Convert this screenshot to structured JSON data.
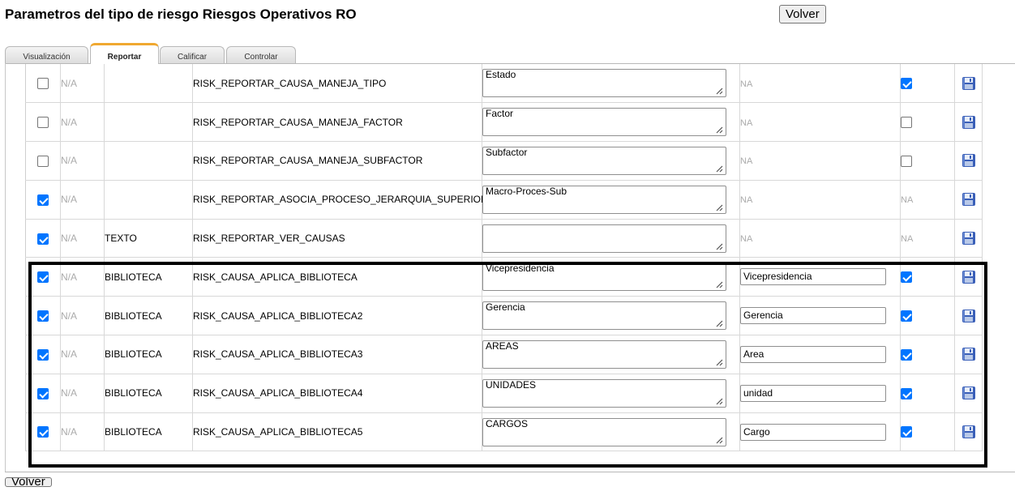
{
  "page": {
    "title": "Parametros del tipo de riesgo Riesgos Operativos RO",
    "volver_label": "Volver",
    "volver_bottom_label": "Volver"
  },
  "tabs": [
    {
      "label": "Visualización",
      "active": false
    },
    {
      "label": "Reportar",
      "active": true
    },
    {
      "label": "Calificar",
      "active": false
    },
    {
      "label": "Controlar",
      "active": false
    }
  ],
  "colors": {
    "active_tab_accent": "#f0a830",
    "checkbox_checked": "#0075ff",
    "highlight_border": "#000000",
    "save_icon_blue": "#3a5fb8"
  },
  "rows": [
    {
      "enabled": false,
      "na": "N/A",
      "type": "",
      "key": "RISK_REPORTAR_CAUSA_MANEJA_TIPO",
      "text": "Estado",
      "value_na": "NA",
      "value": null,
      "flag": "checked",
      "icon": "save-icon"
    },
    {
      "enabled": false,
      "na": "N/A",
      "type": "",
      "key": "RISK_REPORTAR_CAUSA_MANEJA_FACTOR",
      "text": "Factor",
      "value_na": "NA",
      "value": null,
      "flag": "unchecked",
      "icon": "save-icon"
    },
    {
      "enabled": false,
      "na": "N/A",
      "type": "",
      "key": "RISK_REPORTAR_CAUSA_MANEJA_SUBFACTOR",
      "text": "Subfactor",
      "value_na": "NA",
      "value": null,
      "flag": "unchecked",
      "icon": "save-icon"
    },
    {
      "enabled": true,
      "na": "N/A",
      "type": "",
      "key": "RISK_REPORTAR_ASOCIA_PROCESO_JERARQUIA_SUPERIOR",
      "text": "Macro-Proces-Sub",
      "value_na": "NA",
      "value": null,
      "flag": "NA",
      "icon": "save-icon"
    },
    {
      "enabled": true,
      "na": "N/A",
      "type": "TEXTO",
      "key": "RISK_REPORTAR_VER_CAUSAS",
      "text": "",
      "value_na": "NA",
      "value": null,
      "flag": "NA",
      "icon": "save-icon"
    },
    {
      "enabled": true,
      "na": "N/A",
      "type": "BIBLIOTECA",
      "key": "RISK_CAUSA_APLICA_BIBLIOTECA",
      "text": "Vicepresidencia",
      "value_na": null,
      "value": "Vicepresidencia",
      "flag": "checked",
      "icon": "save-icon"
    },
    {
      "enabled": true,
      "na": "N/A",
      "type": "BIBLIOTECA",
      "key": "RISK_CAUSA_APLICA_BIBLIOTECA2",
      "text": "Gerencia",
      "value_na": null,
      "value": "Gerencia",
      "flag": "checked",
      "icon": "save-icon"
    },
    {
      "enabled": true,
      "na": "N/A",
      "type": "BIBLIOTECA",
      "key": "RISK_CAUSA_APLICA_BIBLIOTECA3",
      "text": "AREAS",
      "value_na": null,
      "value": "Area",
      "flag": "checked",
      "icon": "save-icon"
    },
    {
      "enabled": true,
      "na": "N/A",
      "type": "BIBLIOTECA",
      "key": "RISK_CAUSA_APLICA_BIBLIOTECA4",
      "text": "UNIDADES",
      "value_na": null,
      "value": "unidad",
      "flag": "checked",
      "icon": "save-icon"
    },
    {
      "enabled": true,
      "na": "N/A",
      "type": "BIBLIOTECA",
      "key": "RISK_CAUSA_APLICA_BIBLIOTECA5",
      "text": "CARGOS",
      "value_na": null,
      "value": "Cargo",
      "flag": "checked",
      "icon": "save-icon"
    }
  ]
}
